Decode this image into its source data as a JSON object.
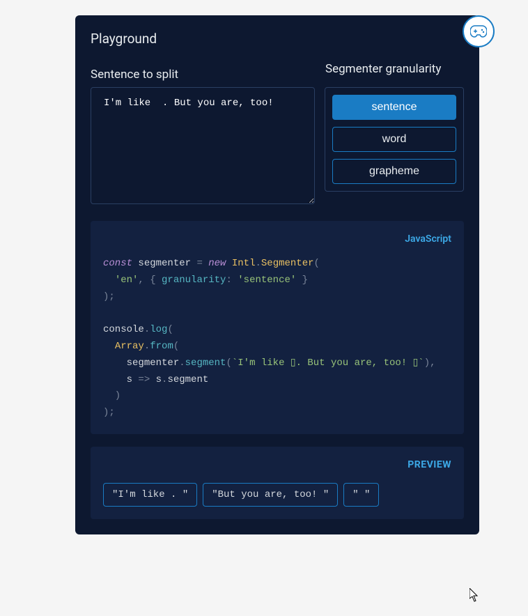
{
  "title": "Playground",
  "inputLabel": "Sentence to split",
  "inputValue": "I'm like  . But you are, too!",
  "granularity": {
    "label": "Segmenter granularity",
    "options": [
      "sentence",
      "word",
      "grapheme"
    ],
    "selected": "sentence"
  },
  "codeLang": "JavaScript",
  "code": {
    "l1_const": "const",
    "l1_var": " segmenter ",
    "l1_eq": "= ",
    "l1_new": "new",
    "l1_cls": " Intl",
    "l1_dot": ".",
    "l1_seg": "Segmenter",
    "l1_paren": "(",
    "l2_indent": "  ",
    "l2_str1": "'en'",
    "l2_c1": ", { ",
    "l2_prop": "granularity",
    "l2_c2": ": ",
    "l2_str2": "'sentence'",
    "l2_c3": " }",
    "l3": ");",
    "l5_console": "console",
    "l5_dot": ".",
    "l5_log": "log",
    "l5_p": "(",
    "l6_indent": "  ",
    "l6_arr": "Array",
    "l6_dot": ".",
    "l6_from": "from",
    "l6_p": "(",
    "l7_indent": "    ",
    "l7_var": "segmenter",
    "l7_dot": ".",
    "l7_seg": "segment",
    "l7_p1": "(",
    "l7_str": "`I'm like ▯. But you are, too! ▯`",
    "l7_p2": "),",
    "l8_indent": "    ",
    "l8_arg": "s ",
    "l8_arrow": "=>",
    "l8_body": " s",
    "l8_dot": ".",
    "l8_prop": "segment",
    "l9": "  )",
    "l10": ");"
  },
  "previewLabel": "PREVIEW",
  "segments": [
    "\"I'm like  . \"",
    "\"But you are, too! \"",
    "\" \""
  ]
}
